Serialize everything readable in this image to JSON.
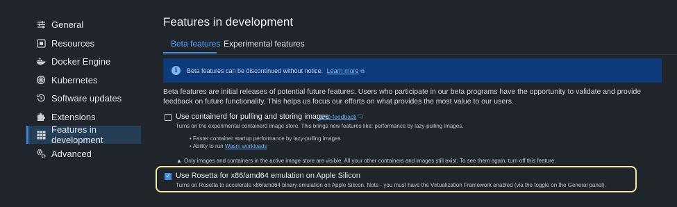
{
  "sidebar": {
    "items": [
      {
        "label": "General",
        "icon": "sliders-icon"
      },
      {
        "label": "Resources",
        "icon": "resources-icon"
      },
      {
        "label": "Docker Engine",
        "icon": "whale-icon"
      },
      {
        "label": "Kubernetes",
        "icon": "helm-icon"
      },
      {
        "label": "Software updates",
        "icon": "history-icon"
      },
      {
        "label": "Extensions",
        "icon": "puzzle-icon"
      },
      {
        "label": "Features in development",
        "icon": "grid-icon",
        "active": true
      },
      {
        "label": "Advanced",
        "icon": "gears-icon"
      }
    ]
  },
  "page": {
    "title": "Features in development",
    "tabs": {
      "beta": "Beta features",
      "experimental": "Experimental features"
    },
    "banner": {
      "text": "Beta features can be discontinued without notice.",
      "link": "Learn more"
    },
    "description": "Beta features are initial releases of potential future features. Users who participate in our beta programs have the opportunity to validate and provide feedback on future functionality. This helps us focus our efforts on what provides the most value to our users.",
    "options": {
      "containerd": {
        "title": "Use containerd for pulling and storing images",
        "checked": false,
        "feedback": "Give feedback",
        "subtitle": "Turns on the experimental containerd image store. This brings new features like: performance by lazy-pulling images.",
        "bullets": [
          "Faster container startup performance by lazy-pulling images",
          "Ability to run"
        ],
        "wasm_link": "Wasm workloads",
        "warning": "Only images and containers in the active image store are visible. All your other containers and images still exist. To see them again, turn off this feature."
      },
      "rosetta": {
        "title": "Use Rosetta for x86/amd64 emulation on Apple Silicon",
        "checked": true,
        "subtitle": "Turns on Rosetta to accelerate x86/amd64 binary emulation on Apple Silicon. Note - you must have the Virtualization Framework enabled (via the toggle on the General panel)."
      }
    }
  },
  "colors": {
    "accent": "#3a8ee6",
    "banner_bg": "#0d3a7a",
    "highlight": "#f2ec95",
    "background": "#1f252b"
  }
}
